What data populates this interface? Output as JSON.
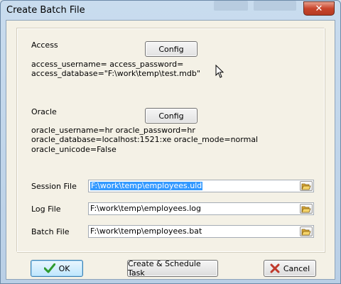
{
  "window": {
    "title": "Create Batch File",
    "close_symbol": "✕"
  },
  "access": {
    "heading": "Access",
    "config_label": "Config",
    "line1": "access_username= access_password=",
    "line2": "access_database=\"F:\\work\\temp\\test.mdb\""
  },
  "oracle": {
    "heading": "Oracle",
    "config_label": "Config",
    "line1": "oracle_username=hr oracle_password=hr",
    "line2": "oracle_database=localhost:1521:xe oracle_mode=normal",
    "line3": "oracle_unicode=False"
  },
  "files": {
    "session": {
      "label": "Session File",
      "value": "F:\\work\\temp\\employees.uld"
    },
    "log": {
      "label": "Log File",
      "value": "F:\\work\\temp\\employees.log"
    },
    "batch": {
      "label": "Batch File",
      "value": "F:\\work\\temp\\employees.bat"
    }
  },
  "buttons": {
    "ok": "OK",
    "schedule": "Create & Schedule Task",
    "cancel": "Cancel"
  },
  "icons": {
    "close": "close-icon",
    "browse": "folder-open-icon",
    "ok": "checkmark-icon",
    "cancel": "x-icon",
    "cursor": "mouse-pointer-icon"
  },
  "colors": {
    "selection": "#3399ff",
    "ok_check": "#2e9b2e",
    "cancel_x": "#c0392b",
    "close_button": "#c8452c"
  }
}
